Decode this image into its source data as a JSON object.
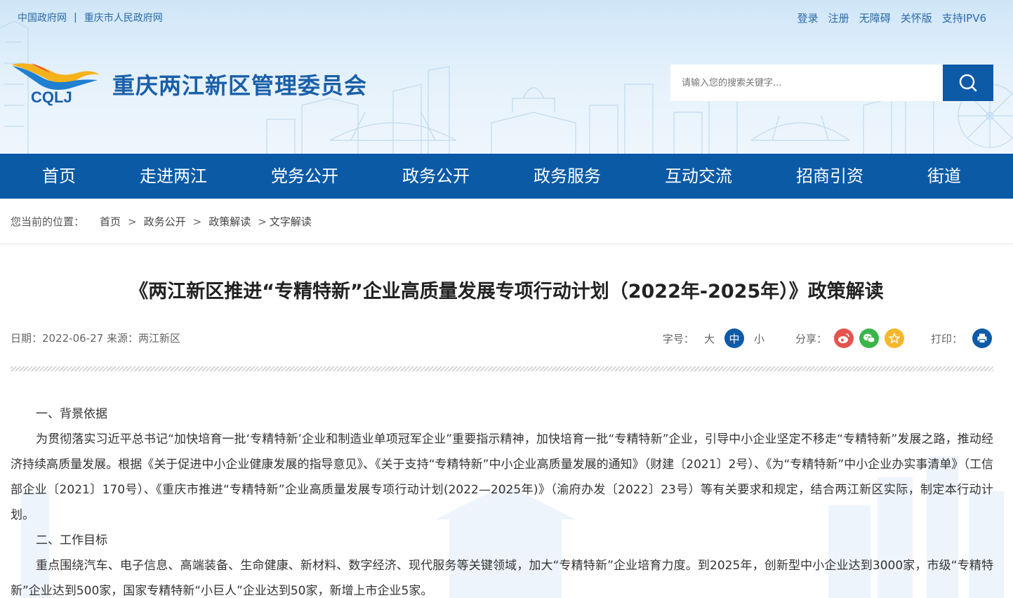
{
  "header": {
    "top_links": [
      "中国政府网",
      "重庆市人民政府网"
    ],
    "top_separator": "|",
    "user_links": [
      "登录",
      "注册",
      "无障碍",
      "关怀版",
      "支持IPV6"
    ],
    "logo_text": "CQLJ",
    "site_title": "重庆两江新区管理委员会",
    "search_placeholder": "请输入您的搜索关键字..."
  },
  "nav": {
    "items": [
      "首页",
      "走进两江",
      "党务公开",
      "政务公开",
      "政务服务",
      "互动交流",
      "招商引资",
      "街道"
    ]
  },
  "breadcrumb": {
    "label": "您当前的位置：",
    "items": [
      "首页",
      "政务公开",
      "政策解读",
      "文字解读"
    ],
    "separator": ">"
  },
  "article": {
    "title": "《两江新区推进“专精特新”企业高质量发展专项行动计划（2022年-2025年）》政策解读",
    "meta": "日期：2022-06-27 来源：两江新区",
    "font_size_label": "字号：",
    "font_sizes": [
      "大",
      "中",
      "小"
    ],
    "share_label": "分享：",
    "print_label": "打印：",
    "paragraphs": [
      "一、背景依据",
      "为贯彻落实习近平总书记“加快培育一批‘专精特新’企业和制造业单项冠军企业”重要指示精神，加快培育一批“专精特新”企业，引导中小企业坚定不移走“专精特新”发展之路，推动经济持续高质量发展。根据《关于促进中小企业健康发展的指导意见》、《关于支持“专精特新”中小企业高质量发展的通知》（财建〔2021〕2号）、《为“专精特新”中小企业办实事清单》（工信部企业〔2021〕170号）、《重庆市推进“专精特新”企业高质量发展专项行动计划(2022—2025年)》（渝府办发〔2022〕23号）等有关要求和规定，结合两江新区实际，制定本行动计划。",
      "二、工作目标",
      "重点围绕汽车、电子信息、高端装备、生命健康、新材料、数字经济、现代服务等关键领域，加大“专精特新”企业培育力度。到2025年，创新型中小企业达到3000家，市级“专精特新”企业达到500家，国家专精特新“小巨人”企业达到50家，新增上市企业5家。"
    ]
  },
  "colors": {
    "primary": "#0a5aa6",
    "weibo": "#e6534f",
    "wechat": "#3bb54a",
    "favorite": "#f5b72a"
  },
  "icons": [
    "search-icon",
    "weibo-icon",
    "wechat-icon",
    "star-icon",
    "print-icon"
  ]
}
